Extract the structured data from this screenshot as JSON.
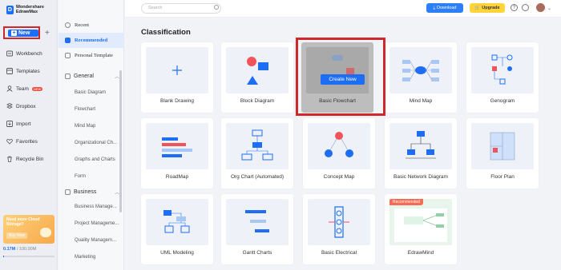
{
  "app": {
    "logo_text": "Wondershare EdrawMax"
  },
  "sidebar": {
    "new_label": "New",
    "items": [
      {
        "label": "Workbench",
        "icon": "workbench-icon"
      },
      {
        "label": "Templates",
        "icon": "templates-icon"
      },
      {
        "label": "Team",
        "icon": "team-icon",
        "badge": "NEW"
      },
      {
        "label": "Dropbox",
        "icon": "dropbox-icon"
      },
      {
        "label": "Import",
        "icon": "import-icon"
      },
      {
        "label": "Favorites",
        "icon": "favorites-icon"
      },
      {
        "label": "Recycle Bin",
        "icon": "recycle-bin-icon"
      }
    ],
    "cloud": {
      "title": "Need more Cloud Storage?",
      "button": "Buy Now"
    },
    "storage": {
      "used": "0.17M",
      "total": " / 100.00M",
      "fraction": 0.0017
    }
  },
  "subnav": {
    "top": [
      {
        "label": "Recent"
      },
      {
        "label": "Recommended"
      },
      {
        "label": "Personal Template"
      }
    ],
    "general": {
      "label": "General",
      "items": [
        "Basic Diagram",
        "Flowchart",
        "Mind Map",
        "Organizational Ch...",
        "Graphs and Charts",
        "Form"
      ]
    },
    "business": {
      "label": "Business",
      "items": [
        "Business Manage...",
        "Project Manageme...",
        "Quality Managem...",
        "Marketing"
      ]
    }
  },
  "topbar": {
    "search_placeholder": "Search",
    "download": "Download",
    "upgrade": "Upgrade",
    "help": "?"
  },
  "main": {
    "title": "Classification",
    "create_new": "Create New",
    "recommended_badge": "Recommended",
    "cards": [
      {
        "label": "Blank Drawing"
      },
      {
        "label": "Block Diagram"
      },
      {
        "label": "Basic Flowchart"
      },
      {
        "label": "Mind Map"
      },
      {
        "label": "Genogram"
      },
      {
        "label": "RoadMap"
      },
      {
        "label": "Org Chart (Automated)"
      },
      {
        "label": "Concept Map"
      },
      {
        "label": "Basic Network Diagram"
      },
      {
        "label": "Floor Plan"
      },
      {
        "label": "UML Modeling"
      },
      {
        "label": "Gantt Charts"
      },
      {
        "label": "Basic Electrical"
      },
      {
        "label": "EdrawMind"
      }
    ]
  },
  "colors": {
    "accent": "#1d6ef5",
    "highlight": "#d0272b",
    "upgrade": "#ffd43b"
  }
}
